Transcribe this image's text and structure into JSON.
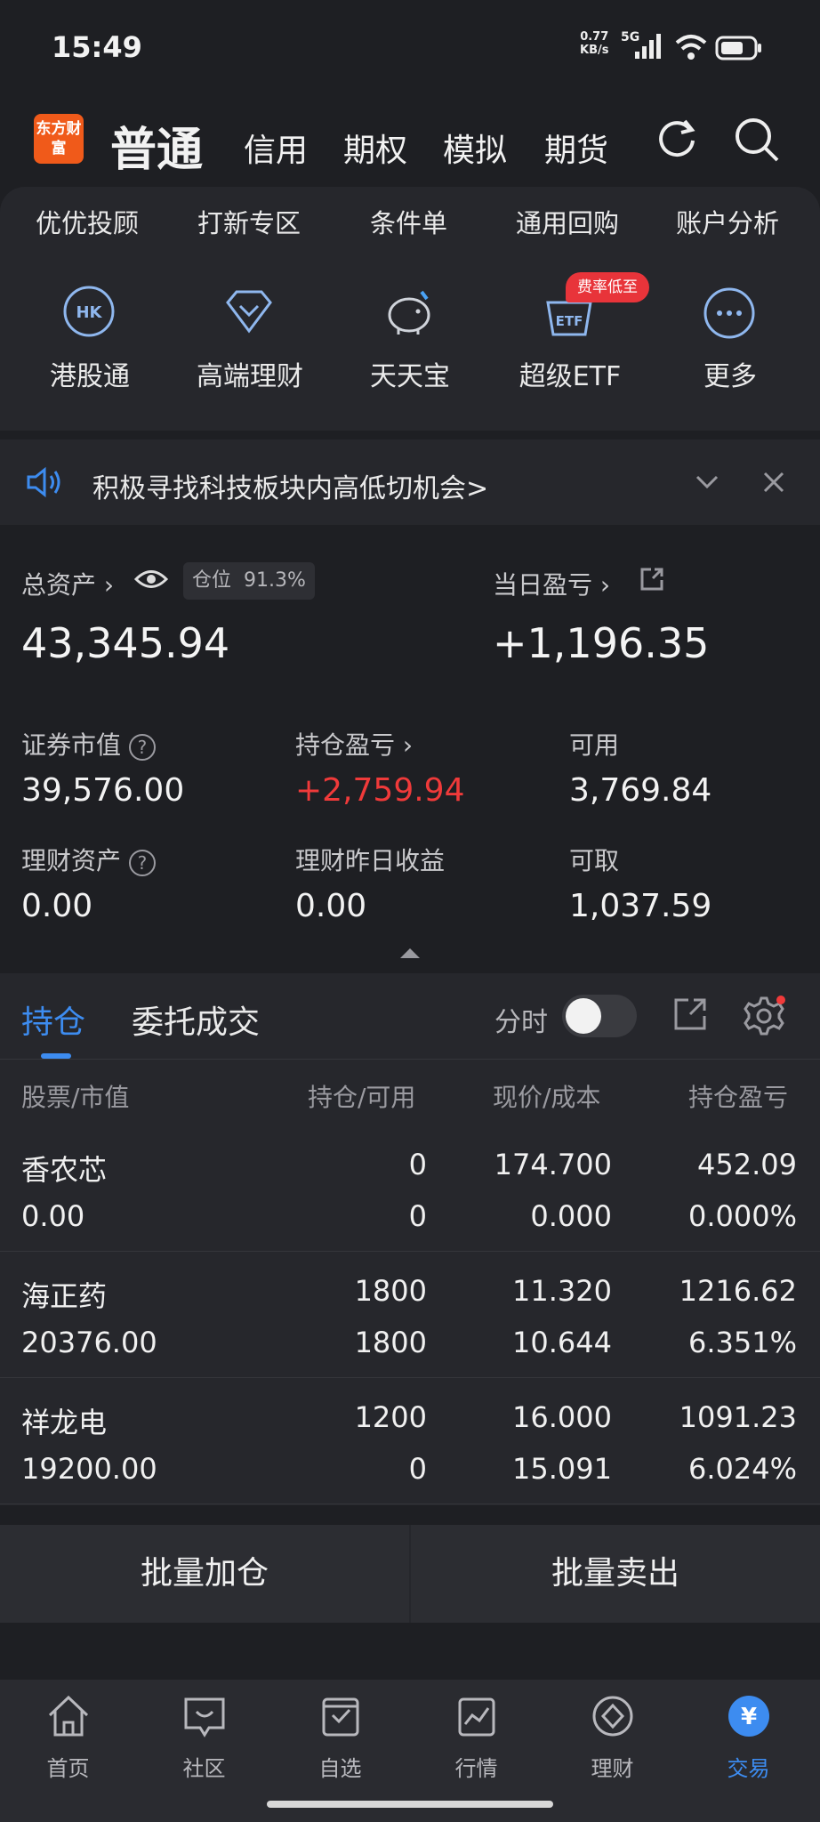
{
  "status": {
    "time": "15:49",
    "net_speed_top": "0.77",
    "net_speed_unit": "KB/s",
    "net_type": "5G"
  },
  "header": {
    "logo_text": "东方财富",
    "tabs": [
      "普通",
      "信用",
      "期权",
      "模拟",
      "期货"
    ]
  },
  "quick_links": [
    "优优投顾",
    "打新专区",
    "条件单",
    "通用回购",
    "账户分析"
  ],
  "icons": [
    {
      "label": "港股通",
      "glyph": "HK"
    },
    {
      "label": "高端理财",
      "glyph": ""
    },
    {
      "label": "天天宝",
      "glyph": ""
    },
    {
      "label": "超级ETF",
      "glyph": "ETF",
      "badge": "费率低至"
    },
    {
      "label": "更多",
      "glyph": "···"
    }
  ],
  "notice": {
    "text": "积极寻找科技板块内高低切机会>"
  },
  "assets": {
    "total_label": "总资产",
    "position_ratio_label": "仓位",
    "position_ratio": "91.3%",
    "total_value": "43,345.94",
    "daily_pl_label": "当日盈亏",
    "daily_pl": "+1,196.35",
    "items": [
      {
        "label": "证券市值",
        "value": "39,576.00"
      },
      {
        "label": "持仓盈亏",
        "value": "+2,759.94"
      },
      {
        "label": "可用",
        "value": "3,769.84"
      },
      {
        "label": "理财资产",
        "value": "0.00"
      },
      {
        "label": "理财昨日收益",
        "value": "0.00"
      },
      {
        "label": "可取",
        "value": "1,037.59"
      }
    ]
  },
  "positions": {
    "tab_hold": "持仓",
    "tab_order": "委托成交",
    "toggle_label": "分时",
    "headers": [
      "股票/市值",
      "持仓/可用",
      "现价/成本",
      "持仓盈亏"
    ],
    "rows": [
      {
        "name": "香农芯",
        "mv": "0.00",
        "hold": "0",
        "avail": "0",
        "price": "174.700",
        "cost": "0.000",
        "pl": "452.09",
        "pl_pct": "0.000%"
      },
      {
        "name": "海正药",
        "mv": "20376.00",
        "hold": "1800",
        "avail": "1800",
        "price": "11.320",
        "cost": "10.644",
        "pl": "1216.62",
        "pl_pct": "6.351%"
      },
      {
        "name": "祥龙电",
        "mv": "19200.00",
        "hold": "1200",
        "avail": "0",
        "price": "16.000",
        "cost": "15.091",
        "pl": "1091.23",
        "pl_pct": "6.024%"
      }
    ]
  },
  "actions": {
    "add": "批量加仓",
    "sell": "批量卖出"
  },
  "nav": [
    {
      "label": "首页"
    },
    {
      "label": "社区"
    },
    {
      "label": "自选"
    },
    {
      "label": "行情"
    },
    {
      "label": "理财"
    },
    {
      "label": "交易",
      "glyph": "¥"
    }
  ],
  "colors": {
    "accent": "#3d8cf0",
    "red": "#f03a3a",
    "brand": "#f05a1a"
  }
}
